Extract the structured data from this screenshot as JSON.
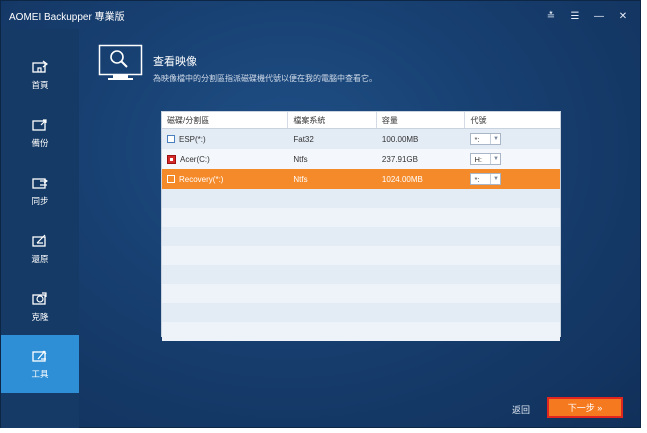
{
  "app": {
    "title": "AOMEI Backupper 專業版"
  },
  "title_controls": {
    "pin": "≛",
    "menu": "☰",
    "minimize": "—",
    "close": "✕"
  },
  "sidebar": {
    "items": [
      {
        "label": "首頁",
        "icon": "home-icon",
        "active": false
      },
      {
        "label": "備份",
        "icon": "backup-icon",
        "active": false
      },
      {
        "label": "同步",
        "icon": "sync-icon",
        "active": false
      },
      {
        "label": "還原",
        "icon": "restore-icon",
        "active": false
      },
      {
        "label": "克隆",
        "icon": "clone-icon",
        "active": false
      },
      {
        "label": "工具",
        "icon": "tools-icon",
        "active": true
      }
    ]
  },
  "header": {
    "title": "查看映像",
    "description": "為映像檔中的分割區指派磁碟機代號以便在我的電腦中查看它。"
  },
  "table": {
    "columns": [
      "磁碟/分割區",
      "檔案系統",
      "容量",
      "代號"
    ],
    "rows": [
      {
        "name": "ESP(*:)",
        "fs": "Fat32",
        "size": "100.00MB",
        "letter": "*:",
        "selected": false,
        "icon": "checkbox"
      },
      {
        "name": "Acer(C:)",
        "fs": "Ntfs",
        "size": "237.91GB",
        "letter": "H:",
        "selected": false,
        "icon": "disk-icon"
      },
      {
        "name": "Recovery(*:)",
        "fs": "Ntfs",
        "size": "1024.00MB",
        "letter": "*:",
        "selected": true,
        "icon": "checkbox"
      }
    ]
  },
  "footer": {
    "back_label": "返回",
    "next_label": "下一步 »"
  },
  "colors": {
    "accent": "#2f8fd6",
    "selected_row": "#f58a2a",
    "next_button": "#f57a1f",
    "next_border": "#e0261e"
  }
}
